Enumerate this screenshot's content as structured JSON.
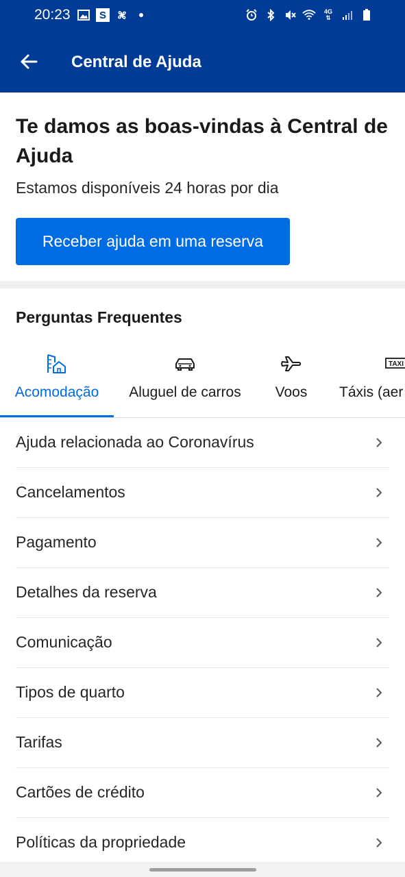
{
  "status_bar": {
    "time": "20:23",
    "left_icons": [
      "image-icon",
      "s-app-icon",
      "fan-icon",
      "dot-icon"
    ],
    "right_icons": [
      "alarm-icon",
      "bluetooth-icon",
      "mute-icon",
      "wifi-icon",
      "4g-icon",
      "signal-icon",
      "battery-icon"
    ],
    "network_label": "4G"
  },
  "toolbar": {
    "title": "Central de Ajuda",
    "back_icon": "arrow-left-icon"
  },
  "welcome": {
    "title": "Te damos as boas-vindas à Central de Ajuda",
    "subtitle": "Estamos disponíveis 24 horas por dia",
    "button_label": "Receber ajuda em uma reserva"
  },
  "faq": {
    "title": "Perguntas Frequentes",
    "tabs": [
      {
        "label": "Acomodação",
        "icon": "accommodation-icon",
        "active": true
      },
      {
        "label": "Aluguel de carros",
        "icon": "car-icon",
        "active": false
      },
      {
        "label": "Voos",
        "icon": "plane-icon",
        "active": false
      },
      {
        "label": "Táxis (aer",
        "icon": "taxi-icon",
        "active": false
      }
    ],
    "items": [
      "Ajuda relacionada ao Coronavírus",
      "Cancelamentos",
      "Pagamento",
      "Detalhes da reserva",
      "Comunicação",
      "Tipos de quarto",
      "Tarifas",
      "Cartões de crédito",
      "Políticas da propriedade"
    ]
  },
  "colors": {
    "brand_dark": "#003b95",
    "brand_blue": "#006ce4"
  }
}
